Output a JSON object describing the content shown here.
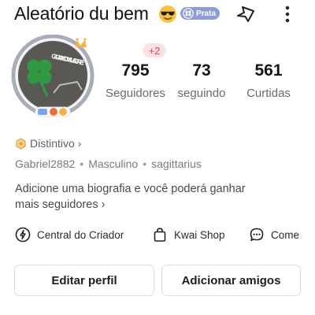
{
  "header": {
    "title": "Aleatório du bem",
    "emoji": "sunglasses-emoji",
    "badge_label": "Prata",
    "share_icon": "share-arrow-icon",
    "more_icon": "more-vertical-icon"
  },
  "profile": {
    "avatar_icon": "avatar",
    "avatar_text": "CADA UM COM SUA SORTE!"
  },
  "stats": {
    "new_badge": "+2",
    "followers": {
      "value": "795",
      "label": "Seguidores"
    },
    "following": {
      "value": "73",
      "label": "seguindo"
    },
    "likes": {
      "value": "561",
      "label": "Curtidas"
    }
  },
  "distintivo": {
    "label": "Distintivo",
    "chevron": "›"
  },
  "meta": {
    "username": "Gabriel2882",
    "gender": "Masculino",
    "sign": "sagittarius"
  },
  "bio": {
    "line1": "Adicione uma biografia e você poderá ganhar",
    "line2": "mais seguidores ›"
  },
  "shortcuts": [
    {
      "label": "Central do Criador",
      "icon": "lightning-circle-icon"
    },
    {
      "label": "Kwai Shop",
      "icon": "shopping-bag-icon"
    },
    {
      "label": "Come",
      "icon": "chat-bubble-icon"
    }
  ],
  "buttons": {
    "edit_profile": "Editar perfil",
    "add_friends": "Adicionar amigos"
  },
  "colors": {
    "badge_bg": "#8e9cd9",
    "new_badge_bg": "#fde1e3",
    "new_badge_text": "#f0434e",
    "distintivo_icon": "#e4a23a",
    "avatar_ring": "#a7aeb9"
  }
}
